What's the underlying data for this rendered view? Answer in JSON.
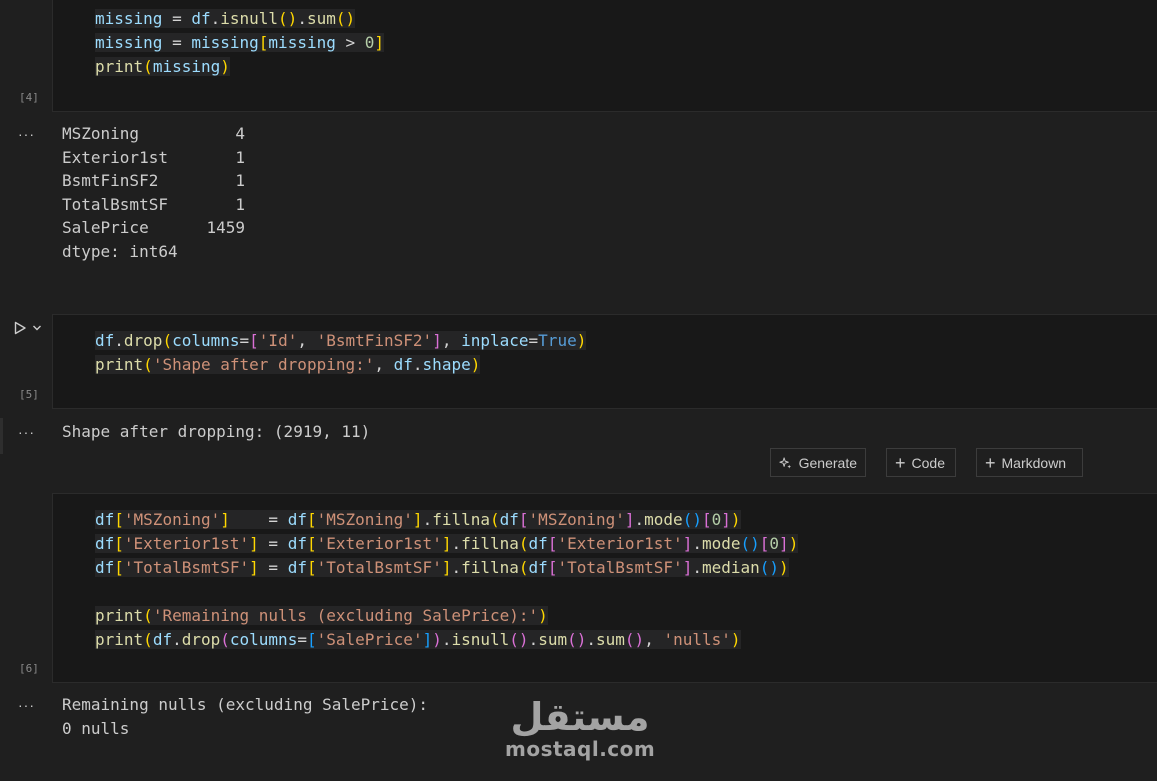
{
  "cells": [
    {
      "exec_count": "[4]",
      "code": [
        [
          [
            "missing",
            "v"
          ],
          [
            " = ",
            "o"
          ],
          [
            "df",
            "v"
          ],
          [
            ".",
            "o"
          ],
          [
            "isnull",
            "f"
          ],
          [
            "()",
            "b1"
          ],
          [
            ".",
            "o"
          ],
          [
            "sum",
            "f"
          ],
          [
            "()",
            "b1"
          ]
        ],
        [
          [
            "missing",
            "v"
          ],
          [
            " = ",
            "o"
          ],
          [
            "missing",
            "v"
          ],
          [
            "[",
            "b1"
          ],
          [
            "missing",
            "v"
          ],
          [
            " > ",
            "o"
          ],
          [
            "0",
            "n"
          ],
          [
            "]",
            "b1"
          ]
        ],
        [
          [
            "print",
            "f"
          ],
          [
            "(",
            "b1"
          ],
          [
            "missing",
            "v"
          ],
          [
            ")",
            "b1"
          ]
        ]
      ],
      "output": [
        "MSZoning          4",
        "Exterior1st       1",
        "BsmtFinSF2        1",
        "TotalBsmtSF       1",
        "SalePrice      1459",
        "dtype: int64"
      ]
    },
    {
      "exec_count": "[5]",
      "code": [
        [
          [
            "df",
            "v"
          ],
          [
            ".",
            "o"
          ],
          [
            "drop",
            "f"
          ],
          [
            "(",
            "b1"
          ],
          [
            "columns",
            "v"
          ],
          [
            "=",
            "o"
          ],
          [
            "[",
            "b2"
          ],
          [
            "'Id'",
            "s"
          ],
          [
            ", ",
            "o"
          ],
          [
            "'BsmtFinSF2'",
            "s"
          ],
          [
            "]",
            "b2"
          ],
          [
            ", ",
            "o"
          ],
          [
            "inplace",
            "v"
          ],
          [
            "=",
            "o"
          ],
          [
            "True",
            "k"
          ],
          [
            ")",
            "b1"
          ]
        ],
        [
          [
            "print",
            "f"
          ],
          [
            "(",
            "b1"
          ],
          [
            "'Shape after dropping:'",
            "s"
          ],
          [
            ", ",
            "o"
          ],
          [
            "df",
            "v"
          ],
          [
            ".",
            "o"
          ],
          [
            "shape",
            "v"
          ],
          [
            ")",
            "b1"
          ]
        ]
      ],
      "output": [
        "Shape after dropping: (2919, 11)"
      ]
    },
    {
      "exec_count": "[6]",
      "code": [
        [
          [
            "df",
            "v"
          ],
          [
            "[",
            "b1"
          ],
          [
            "'MSZoning'",
            "s"
          ],
          [
            "]",
            "b1"
          ],
          [
            "   ",
            "ws"
          ],
          [
            " = ",
            "o"
          ],
          [
            "df",
            "v"
          ],
          [
            "[",
            "b1"
          ],
          [
            "'MSZoning'",
            "s"
          ],
          [
            "]",
            "b1"
          ],
          [
            ".",
            "o"
          ],
          [
            "fillna",
            "f"
          ],
          [
            "(",
            "b1"
          ],
          [
            "df",
            "v"
          ],
          [
            "[",
            "b2"
          ],
          [
            "'MSZoning'",
            "s"
          ],
          [
            "]",
            "b2"
          ],
          [
            ".",
            "o"
          ],
          [
            "mode",
            "f"
          ],
          [
            "()",
            "b3"
          ],
          [
            "[",
            "b2"
          ],
          [
            "0",
            "n"
          ],
          [
            "]",
            "b2"
          ],
          [
            ")",
            "b1"
          ]
        ],
        [
          [
            "df",
            "v"
          ],
          [
            "[",
            "b1"
          ],
          [
            "'Exterior1st'",
            "s"
          ],
          [
            "]",
            "b1"
          ],
          [
            " = ",
            "o"
          ],
          [
            "df",
            "v"
          ],
          [
            "[",
            "b1"
          ],
          [
            "'Exterior1st'",
            "s"
          ],
          [
            "]",
            "b1"
          ],
          [
            ".",
            "o"
          ],
          [
            "fillna",
            "f"
          ],
          [
            "(",
            "b1"
          ],
          [
            "df",
            "v"
          ],
          [
            "[",
            "b2"
          ],
          [
            "'Exterior1st'",
            "s"
          ],
          [
            "]",
            "b2"
          ],
          [
            ".",
            "o"
          ],
          [
            "mode",
            "f"
          ],
          [
            "()",
            "b3"
          ],
          [
            "[",
            "b2"
          ],
          [
            "0",
            "n"
          ],
          [
            "]",
            "b2"
          ],
          [
            ")",
            "b1"
          ]
        ],
        [
          [
            "df",
            "v"
          ],
          [
            "[",
            "b1"
          ],
          [
            "'TotalBsmtSF'",
            "s"
          ],
          [
            "]",
            "b1"
          ],
          [
            " = ",
            "o"
          ],
          [
            "df",
            "v"
          ],
          [
            "[",
            "b1"
          ],
          [
            "'TotalBsmtSF'",
            "s"
          ],
          [
            "]",
            "b1"
          ],
          [
            ".",
            "o"
          ],
          [
            "fillna",
            "f"
          ],
          [
            "(",
            "b1"
          ],
          [
            "df",
            "v"
          ],
          [
            "[",
            "b2"
          ],
          [
            "'TotalBsmtSF'",
            "s"
          ],
          [
            "]",
            "b2"
          ],
          [
            ".",
            "o"
          ],
          [
            "median",
            "f"
          ],
          [
            "()",
            "b3"
          ],
          [
            ")",
            "b1"
          ]
        ],
        [
          [
            "",
            "o"
          ]
        ],
        [
          [
            "print",
            "f"
          ],
          [
            "(",
            "b1"
          ],
          [
            "'Remaining nulls (excluding SalePrice):'",
            "s"
          ],
          [
            ")",
            "b1"
          ]
        ],
        [
          [
            "print",
            "f"
          ],
          [
            "(",
            "b1"
          ],
          [
            "df",
            "v"
          ],
          [
            ".",
            "o"
          ],
          [
            "drop",
            "f"
          ],
          [
            "(",
            "b2"
          ],
          [
            "columns",
            "v"
          ],
          [
            "=",
            "o"
          ],
          [
            "[",
            "b3"
          ],
          [
            "'SalePrice'",
            "s"
          ],
          [
            "]",
            "b3"
          ],
          [
            ")",
            "b2"
          ],
          [
            ".",
            "o"
          ],
          [
            "isnull",
            "f"
          ],
          [
            "()",
            "b2"
          ],
          [
            ".",
            "o"
          ],
          [
            "sum",
            "f"
          ],
          [
            "()",
            "b2"
          ],
          [
            ".",
            "o"
          ],
          [
            "sum",
            "f"
          ],
          [
            "()",
            "b2"
          ],
          [
            ", ",
            "o"
          ],
          [
            "'nulls'",
            "s"
          ],
          [
            ")",
            "b1"
          ]
        ]
      ],
      "output": [
        "Remaining nulls (excluding SalePrice):",
        "0 nulls"
      ]
    }
  ],
  "toolbar": {
    "generate_label": "Generate",
    "code_label": "Code",
    "markdown_label": "Markdown"
  },
  "output_menu": "···",
  "watermark": {
    "arabic": "مستقل",
    "latin": "mostaql.com"
  },
  "colors": {
    "variable": "#9cdcfe",
    "function": "#dcdcaa",
    "string": "#ce9178",
    "keyword": "#569cd6",
    "number": "#b5cea8",
    "bracket_1": "#ffd700",
    "bracket_2": "#da70d6",
    "bracket_3": "#179fff"
  }
}
